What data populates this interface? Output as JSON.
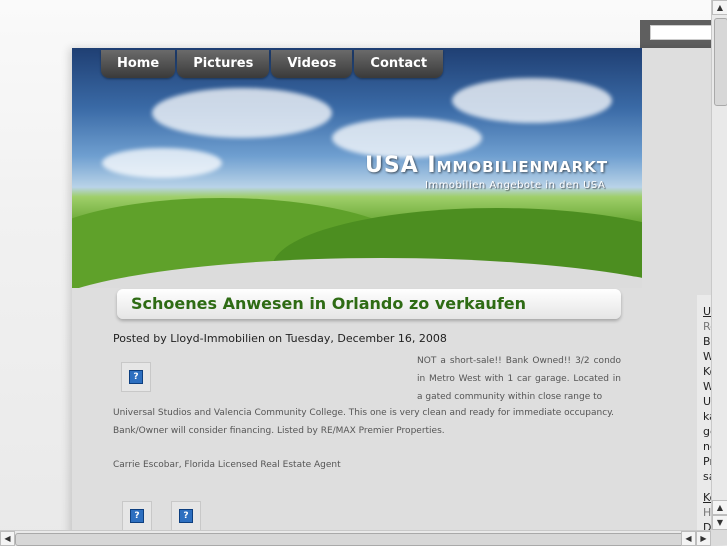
{
  "nav": {
    "items": [
      "Home",
      "Pictures",
      "Videos",
      "Contact"
    ]
  },
  "site": {
    "title": "USA Immobilienmarkt",
    "subtitle": "Immobilien Angebote in den USA"
  },
  "post": {
    "title": "Schoenes Anwesen in Orlando zo verkaufen",
    "meta": "Posted by Lloyd-Immobilien on Tuesday, December 16, 2008",
    "body_right": "NOT a short-sale!! Bank Owned!! 3/2 condo in Metro West with 1 car garage. Located in a gated community within close range to",
    "body_full": "Universal Studios and Valencia Community College. This one is very clean and ready for immediate occupancy. Bank/Owner will consider financing. Listed by RE/MAX Premier Properties.",
    "author": "Carrie Escobar, Florida Licensed Real Estate Agent"
  },
  "sidebar": {
    "lines": [
      "U",
      "Re",
      "Be",
      "W",
      "Ko",
      "W",
      "U",
      "ka",
      "ge",
      "ne",
      "Pr",
      "sa",
      "Ko",
      "H",
      "D"
    ]
  },
  "icons": {
    "broken_image": "broken-image-icon"
  }
}
